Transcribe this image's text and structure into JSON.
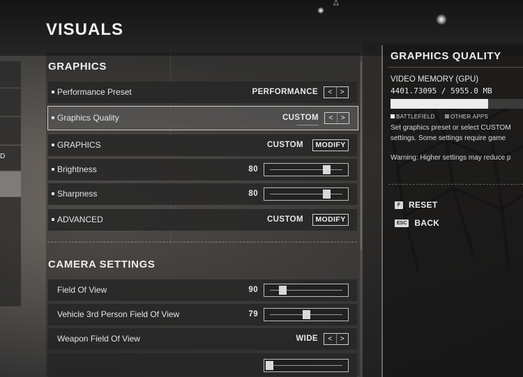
{
  "page": {
    "title": "VISUALS"
  },
  "side_nav": {
    "stub_label": "D"
  },
  "graphics_section": {
    "title": "GRAPHICS",
    "rows": [
      {
        "label": "Performance Preset",
        "type": "selector",
        "value": "PERFORMANCE"
      },
      {
        "label": "Graphics Quality",
        "type": "selector",
        "value": "CUSTOM",
        "selected": true
      },
      {
        "label": "GRAPHICS",
        "type": "modify",
        "value": "CUSTOM",
        "button": "MODIFY"
      },
      {
        "label": "Brightness",
        "type": "slider",
        "value": "80",
        "level": 0.8
      },
      {
        "label": "Sharpness",
        "type": "slider",
        "value": "80",
        "level": 0.8
      },
      {
        "label": "ADVANCED",
        "type": "modify",
        "value": "CUSTOM",
        "button": "MODIFY"
      }
    ]
  },
  "camera_section": {
    "title": "CAMERA SETTINGS",
    "rows": [
      {
        "label": "Field Of View",
        "type": "slider",
        "value": "90",
        "level": 0.15
      },
      {
        "label": "Vehicle 3rd Person Field Of View",
        "type": "slider",
        "value": "79",
        "level": 0.5
      },
      {
        "label": "Weapon Field Of View",
        "type": "selector",
        "value": "WIDE"
      }
    ]
  },
  "controls": {
    "arrow_left": "<",
    "arrow_right": ">"
  },
  "info_panel": {
    "title": "GRAPHICS QUALITY",
    "video_memory_label": "VIDEO MEMORY (GPU)",
    "video_memory_value": "4401.73095 / 5955.0 MB",
    "memory_usage_fraction": 0.739,
    "legend": {
      "battlefield": "BATTLEFIELD",
      "other_apps": "OTHER APPS"
    },
    "description_line1": "Set graphics preset or select CUSTOM",
    "description_line2": "settings. Some settings require game",
    "warning": "Warning: Higher settings may reduce p",
    "actions": [
      {
        "key": "F",
        "label": "RESET"
      },
      {
        "key": "ESC",
        "label": "BACK"
      }
    ]
  },
  "colors": {
    "accent": "#e6e6e6",
    "panel": "#262626",
    "selected_outline": "#e6e6e6"
  },
  "icons": {
    "top_indicator": "triangle-up-outline-icon"
  }
}
